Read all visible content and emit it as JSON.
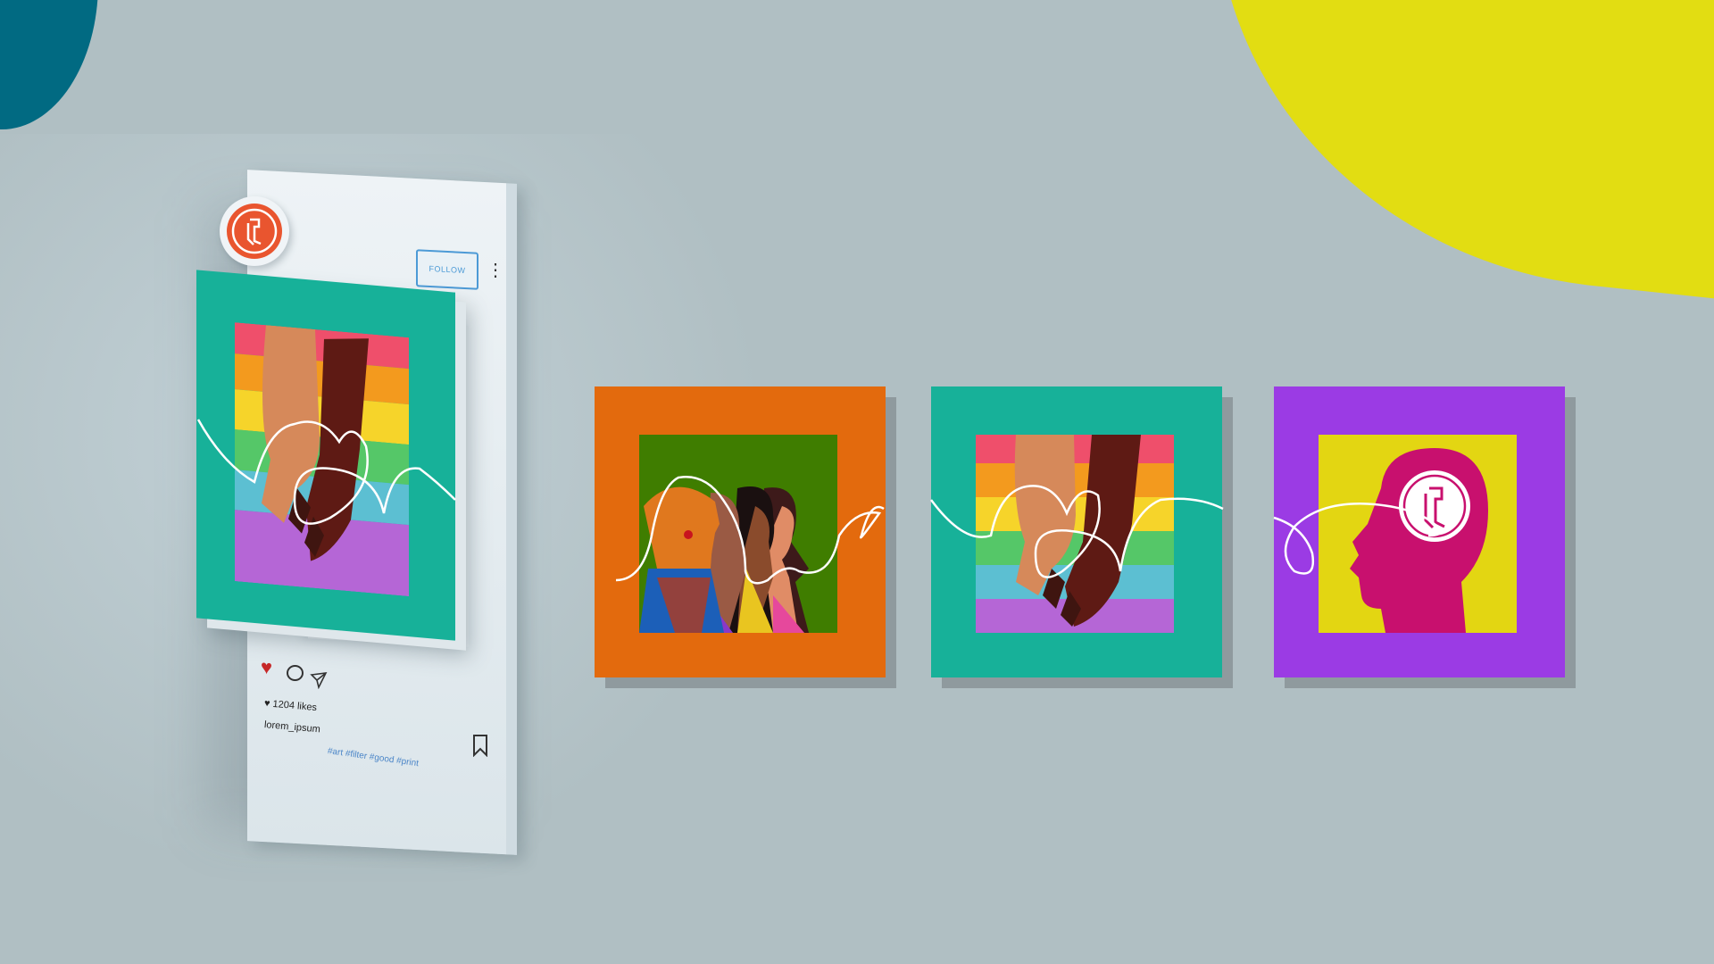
{
  "post": {
    "follow_label": "FOLLOW",
    "likes_text": "1204 likes",
    "username": "lorem_ipsum",
    "hashtags": "#art #filter #good #print"
  },
  "icons": {
    "heart": "heart-icon",
    "comment": "comment-icon",
    "send": "send-icon",
    "bookmark": "bookmark-icon",
    "more": "more-dots-icon",
    "logo": "brand-logo-icon"
  },
  "colors": {
    "background": "#b0bfc3",
    "teal_blob": "#016a82",
    "yellow_blob": "#e2dd12",
    "orange_tile": "#e36a0d",
    "teal_tile": "#17b199",
    "purple_tile": "#9b3be4",
    "logo_orange": "#e9552f",
    "head_magenta": "#c8106e"
  }
}
